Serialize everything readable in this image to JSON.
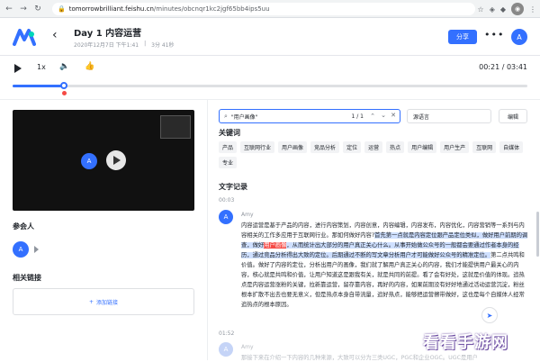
{
  "browser": {
    "url_host": "tomorrowbrilliant.feishu.cn",
    "url_path": "/minutes/obcnqr1kc2jgf65bb4ips5uu",
    "back_icon": "arrow-left-icon",
    "forward_icon": "arrow-right-icon",
    "reload_icon": "reload-icon"
  },
  "header": {
    "title": "Day 1 内容运营",
    "date": "2020年12月7日 下午1:41",
    "duration": "3分 41秒",
    "share_label": "分享",
    "user_initial": "A"
  },
  "player": {
    "speed": "1x",
    "time": "00:21 / 03:41",
    "progress": 0.1
  },
  "left": {
    "video_initial": "A",
    "participants_title": "参会人",
    "participant_initial": "A",
    "links_title": "相关链接",
    "add_link_label": "添加链接"
  },
  "search": {
    "value": "\"用户画像\"",
    "count": "1 / 1",
    "lang_placeholder": "源语言",
    "edit_label": "编辑"
  },
  "keywords": {
    "title": "关键词",
    "items": [
      "产品",
      "互联网行业",
      "用户画像",
      "竞品分析",
      "定位",
      "运营",
      "热点",
      "用户编辑",
      "用户生产",
      "互联网",
      "自媒体",
      "专业"
    ]
  },
  "transcript": {
    "title": "文字记录",
    "entries": [
      {
        "time": "00:03",
        "speaker": "Amy",
        "initial": "A",
        "text_before": "内容运营是基于产品的内容，进行内容策划，内容创意，内容编辑，内容发布，内容优化，内容营销等一系列与内容相关的工作多应用于互联网行业。那如何做好内容?",
        "text_hl1": "首先第一点就是内容定位跟产品定位类似，做好用户前期的调查，做好",
        "text_hl_red": "用户画像",
        "text_hl2": "，从而统计出大部分的用户真正关心什么。从事开始做公众号的一般都会要通过作者本身的经历，通过竞品分析得出大致的定位。后期通过不断的写文章分析用户才可能做好公众号的精准定位。",
        "text_after": "第二点共鸣和价值。做好了内容的定位，分析出用户的画像，我们就了解用户真正关心的内容，我们才能提供用户最关心的内容，核心就是共鸣和价值，让用户知道这是跟我有关，就是共同的前提。看了会有好处，这就是价值的体现。追热点是内容运营涨粉的关键，拉新靠运营，留存靠内容，再好的内容，如果前期没有好好地通过活动运营沉淀，粉丝根本扩散不出去也要无意义，但是热点本身自带流量，追好热点，能够把运营擦带做好，这也是每个自媒体人经常追热点的根本原因。"
      },
      {
        "time": "01:52",
        "speaker": "Amy",
        "initial": "A",
        "text": "那接下来在介绍一下内容的几种来源，大致可以分为三类UGC，PGC和企业OGC。UGC是用户"
      }
    ]
  },
  "watermark": "看看手游网",
  "colors": {
    "accent": "#3370ff",
    "highlight": "#cfe0ff",
    "search_hit": "#f54a45"
  }
}
